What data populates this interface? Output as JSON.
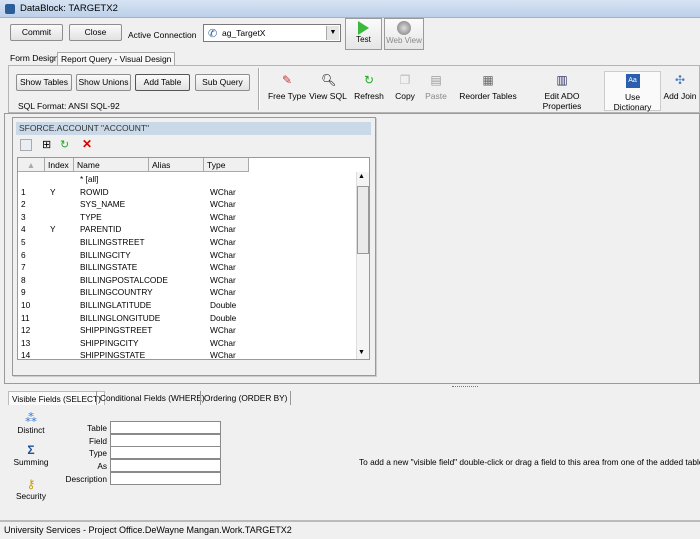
{
  "window": {
    "title": "DataBlock: TARGETX2"
  },
  "header": {
    "commit": "Commit",
    "close": "Close",
    "active_connection_label": "Active Connection",
    "connection_value": "ag_TargetX",
    "test": "Test",
    "web_view": "Web View"
  },
  "tabs": [
    "Form Design",
    "Report Query - Visual Design"
  ],
  "toolbar": {
    "show_tables": "Show Tables",
    "show_unions": "Show Unions",
    "add_table": "Add Table",
    "sub_query": "Sub Query",
    "sql_format": "SQL Format: ANSI SQL-92",
    "tools": [
      {
        "label": "Free Type",
        "icon": "free-type-icon"
      },
      {
        "label": "View SQL",
        "icon": "magnifier-icon"
      },
      {
        "label": "Refresh",
        "icon": "refresh-icon"
      },
      {
        "label": "Copy",
        "icon": "copy-icon"
      },
      {
        "label": "Paste",
        "icon": "paste-icon"
      },
      {
        "label": "Reorder Tables",
        "icon": "reorder-icon"
      },
      {
        "label": "Edit ADO Properties",
        "icon": "properties-icon"
      },
      {
        "label": "Use Dictionary",
        "icon": "dictionary-icon"
      },
      {
        "label": "Add Join",
        "icon": "join-icon"
      }
    ]
  },
  "table_panel": {
    "title": "SFORCE.ACCOUNT \"ACCOUNT\"",
    "columns": [
      "",
      "Index",
      "Name",
      "Alias",
      "Type"
    ],
    "rows": [
      {
        "n": "",
        "index": "",
        "name": "* [all]",
        "alias": "",
        "type": ""
      },
      {
        "n": "1",
        "index": "Y",
        "name": "ROWID",
        "alias": "",
        "type": "WChar"
      },
      {
        "n": "2",
        "index": "",
        "name": "SYS_NAME",
        "alias": "",
        "type": "WChar"
      },
      {
        "n": "3",
        "index": "",
        "name": "TYPE",
        "alias": "",
        "type": "WChar"
      },
      {
        "n": "4",
        "index": "Y",
        "name": "PARENTID",
        "alias": "",
        "type": "WChar"
      },
      {
        "n": "5",
        "index": "",
        "name": "BILLINGSTREET",
        "alias": "",
        "type": "WChar"
      },
      {
        "n": "6",
        "index": "",
        "name": "BILLINGCITY",
        "alias": "",
        "type": "WChar"
      },
      {
        "n": "7",
        "index": "",
        "name": "BILLINGSTATE",
        "alias": "",
        "type": "WChar"
      },
      {
        "n": "8",
        "index": "",
        "name": "BILLINGPOSTALCODE",
        "alias": "",
        "type": "WChar"
      },
      {
        "n": "9",
        "index": "",
        "name": "BILLINGCOUNTRY",
        "alias": "",
        "type": "WChar"
      },
      {
        "n": "10",
        "index": "",
        "name": "BILLINGLATITUDE",
        "alias": "",
        "type": "Double"
      },
      {
        "n": "11",
        "index": "",
        "name": "BILLINGLONGITUDE",
        "alias": "",
        "type": "Double"
      },
      {
        "n": "12",
        "index": "",
        "name": "SHIPPINGSTREET",
        "alias": "",
        "type": "WChar"
      },
      {
        "n": "13",
        "index": "",
        "name": "SHIPPINGCITY",
        "alias": "",
        "type": "WChar"
      },
      {
        "n": "14",
        "index": "",
        "name": "SHIPPINGSTATE",
        "alias": "",
        "type": "WChar"
      }
    ]
  },
  "bottom": {
    "tabs": [
      "Visible Fields (SELECT)",
      "Conditional Fields (WHERE)",
      "Ordering (ORDER BY)"
    ],
    "side": [
      "Distinct",
      "Summing",
      "Security"
    ],
    "fields": [
      "Table",
      "Field",
      "Type",
      "As",
      "Description"
    ],
    "hint": "To add a new \"visible field\" double-click or drag a field to this area from one of the added tables"
  },
  "status": "University Services - Project Office.DeWayne Mangan.Work.TARGETX2"
}
